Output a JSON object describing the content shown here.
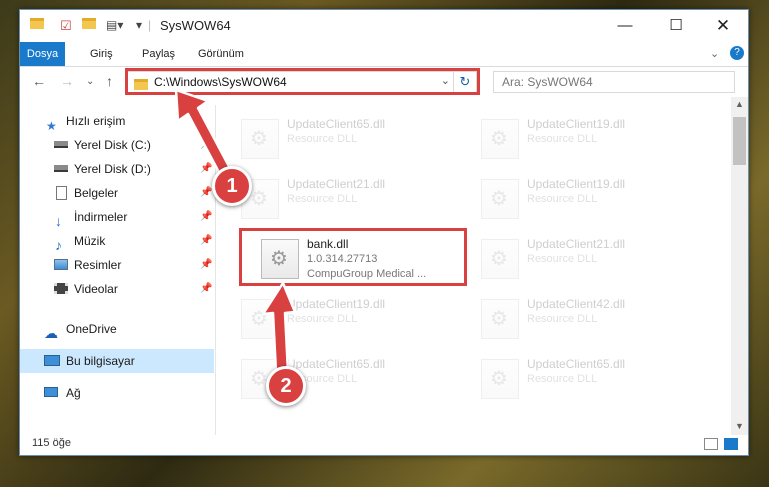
{
  "window": {
    "title": "SysWOW64"
  },
  "ribbon": {
    "tabs": [
      "Dosya",
      "Giriş",
      "Paylaş",
      "Görünüm"
    ]
  },
  "address": {
    "path": "C:\\Windows\\SysWOW64",
    "search_placeholder": "Ara: SysWOW64"
  },
  "sidebar": {
    "items": [
      {
        "label": "Hızlı erişim",
        "pinned": false
      },
      {
        "label": "Yerel Disk (C:)",
        "pinned": true
      },
      {
        "label": "Yerel Disk (D:)",
        "pinned": true
      },
      {
        "label": "Belgeler",
        "pinned": true
      },
      {
        "label": "İndirmeler",
        "pinned": true
      },
      {
        "label": "Müzik",
        "pinned": true
      },
      {
        "label": "Resimler",
        "pinned": true
      },
      {
        "label": "Videolar",
        "pinned": true
      },
      {
        "label": "OneDrive",
        "pinned": false
      },
      {
        "label": "Bu bilgisayar",
        "pinned": false
      },
      {
        "label": "Ağ",
        "pinned": false
      }
    ],
    "selected": "Bu bilgisayar"
  },
  "files": [
    {
      "name": "UpdateClient65.dll",
      "desc": "Resource DLL"
    },
    {
      "name": "UpdateClient19.dll",
      "desc": "Resource DLL"
    },
    {
      "name": "UpdateClient21.dll",
      "desc": "Resource DLL"
    },
    {
      "name": "UpdateClient19.dll",
      "desc": "Resource DLL"
    },
    {
      "name": "bank.dll",
      "version": "1.0.314.27713",
      "company": "CompuGroup Medical ...",
      "highlighted": true
    },
    {
      "name": "UpdateClient21.dll",
      "desc": "Resource DLL"
    },
    {
      "name": "UpdateClient19.dll",
      "desc": "Resource DLL"
    },
    {
      "name": "UpdateClient42.dll",
      "desc": "Resource DLL"
    },
    {
      "name": "UpdateClient65.dll",
      "desc": "Resource DLL"
    },
    {
      "name": "UpdateClient65.dll",
      "desc": "Resource DLL"
    }
  ],
  "status": {
    "count": "115 öğe"
  },
  "callouts": [
    "1",
    "2"
  ],
  "colors": {
    "accent": "#1979ca",
    "highlight": "#d94040",
    "selected": "#cce8ff"
  }
}
